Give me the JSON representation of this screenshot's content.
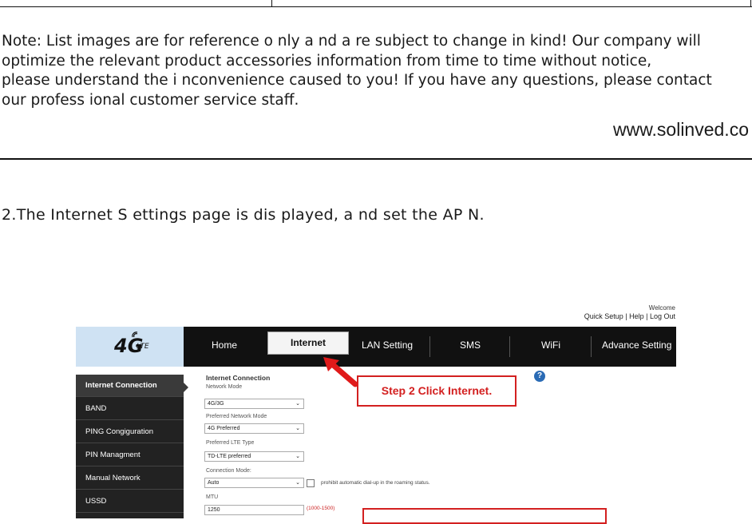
{
  "note": {
    "lines": [
      "Note: List images are for reference o nly a nd a re  subject to change in kind!  Our company  will",
      "optimize  the  relevant  product  accessories  information  from  time  to  time  without  notice,",
      "please  understand  the i nconvenience  caused to you! If  you have any questions,  please  contact",
      " our profess ional customer service staff."
    ],
    "website": "www.solinved.co"
  },
  "step_text": "2.The Internet S ettings page is dis played, a nd set the AP N.",
  "router": {
    "welcome": "Welcome",
    "top_links": "Quick Setup | Help | Log Out",
    "logo_text": "4G",
    "logo_sub": "LTE",
    "nav": {
      "home": "Home",
      "internet": "Internet",
      "lan": "LAN Setting",
      "sms": "SMS",
      "wifi": "WiFi",
      "advance": "Advance Setting"
    },
    "sidebar": [
      "Internet Connection",
      "BAND",
      "PING Congiguration",
      "PIN Managment",
      "Manual Network",
      "USSD"
    ],
    "form": {
      "section_title": "Internet Connection",
      "network_mode_label": "Network Mode",
      "network_mode_value": "4G/3G",
      "preferred_label": "Preferred Network Mode",
      "preferred_value": "4G Preferred",
      "lte_type_label": "Preferred LTE Type",
      "lte_type_value": "TD-LTE preferred",
      "connection_mode_label": "Connection Mode:",
      "connection_mode_value": "Auto",
      "roaming_label": "prohibit automatic dial-up in the roaming status.",
      "mtu_label": "MTU",
      "mtu_value": "1250",
      "mtu_hint": "(1000-1500)"
    },
    "help_icon": "?",
    "callout_text": "Step 2 Click Internet.",
    "colors": {
      "callout": "#d32020",
      "nav_bg": "#111111",
      "sidebar_bg": "#222222",
      "logo_bg": "#cfe2f3"
    }
  }
}
